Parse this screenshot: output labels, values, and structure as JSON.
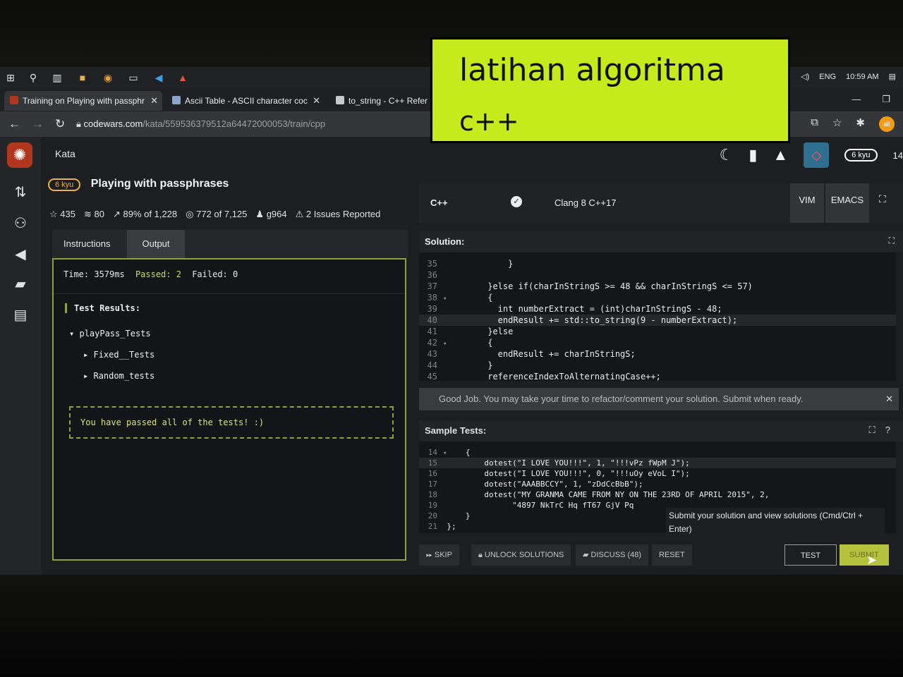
{
  "taskbar": {
    "language": "ENG",
    "time": "10:59 AM"
  },
  "browser": {
    "tabs": [
      {
        "label": "Training on Playing with passphr"
      },
      {
        "label": "Ascii Table - ASCII character coc"
      },
      {
        "label": "to_string - C++ Refer"
      }
    ],
    "url_host": "codewars.com",
    "url_path": "/kata/559536379512a64472000053/train/cpp",
    "profile_label": "all"
  },
  "app": {
    "section": "Kata",
    "user_rank": "6 kyu",
    "honor": "14",
    "kata": {
      "rank": "6 kyu",
      "title": "Playing with passphrases",
      "stats": {
        "stars": "435",
        "collections": "80",
        "satisfaction": "89% of 1,228",
        "completed": "772 of 7,125",
        "author": "g964",
        "issues": "2 Issues Reported"
      }
    },
    "left_tabs": {
      "instructions": "Instructions",
      "output": "Output"
    },
    "output": {
      "time": "Time: 3579ms",
      "passed": "Passed: 2",
      "failed": "Failed: 0",
      "results_heading": "Test Results:",
      "tree": [
        "playPass_Tests",
        "Fixed__Tests",
        "Random_tests"
      ],
      "passed_message": "You have passed all of the tests! :)"
    },
    "language": "C++",
    "compiler": "Clang 8 C++17",
    "modes": {
      "vim": "VIM",
      "emacs": "EMACS"
    },
    "solution_label": "Solution:",
    "solution_lines": [
      {
        "n": "35",
        "code": "            }"
      },
      {
        "n": "36",
        "code": ""
      },
      {
        "n": "37",
        "code": "        }else if(charInStringS >= 48 && charInStringS <= 57)"
      },
      {
        "n": "38",
        "code": "        {",
        "fold": true
      },
      {
        "n": "39",
        "code": "          int numberExtract = (int)charInStringS - 48;"
      },
      {
        "n": "40",
        "code": "          endResult += std::to_string(9 - numberExtract);",
        "highlight": true
      },
      {
        "n": "41",
        "code": "        }else"
      },
      {
        "n": "42",
        "code": "        {",
        "fold": true
      },
      {
        "n": "43",
        "code": "          endResult += charInStringS;"
      },
      {
        "n": "44",
        "code": "        }"
      },
      {
        "n": "45",
        "code": "        referenceIndexToAlternatingCase++;"
      }
    ],
    "toast": "Good Job. You may take your time to refactor/comment your solution. Submit when ready.",
    "sample_label": "Sample Tests:",
    "sample_lines": [
      {
        "n": "14",
        "code": "    {",
        "fold": true
      },
      {
        "n": "15",
        "code": "        dotest(\"I LOVE YOU!!!\", 1, \"!!!vPz fWpM J\");",
        "highlight": true
      },
      {
        "n": "16",
        "code": "        dotest(\"I LOVE YOU!!!\", 0, \"!!!uOy eVoL I\");"
      },
      {
        "n": "17",
        "code": "        dotest(\"AAABBCCY\", 1, \"zDdCcBbB\");"
      },
      {
        "n": "18",
        "code": "        dotest(\"MY GRANMA CAME FROM NY ON THE 23RD OF APRIL 2015\", 2,"
      },
      {
        "n": "19",
        "code": "              \"4897 NkTrC Hq fT67 GjV Pq"
      },
      {
        "n": "20",
        "code": "    }"
      },
      {
        "n": "21",
        "code": "};"
      }
    ],
    "tooltip": "Submit your solution and view solutions (Cmd/Ctrl + Enter)",
    "buttons": {
      "skip": "SKIP",
      "unlock": "UNLOCK SOLUTIONS",
      "discuss": "DISCUSS (48)",
      "reset": "RESET",
      "test": "TEST",
      "submit": "SUBMIT"
    }
  },
  "caption": {
    "line1": "latihan algoritma",
    "line2": "c++"
  },
  "colors": {
    "accent": "#8ea13a",
    "caption_bg": "#c6ea1c",
    "codewars_red": "#b1361e"
  }
}
